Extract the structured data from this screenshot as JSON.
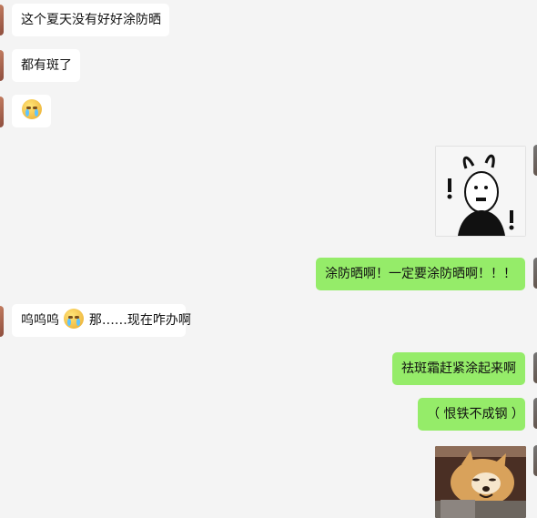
{
  "messages": [
    {
      "side": "left",
      "text": "这个夏天没有好好涂防晒"
    },
    {
      "side": "left",
      "text": "都有斑了"
    },
    {
      "side": "left",
      "emoji": "crying-emoji"
    },
    {
      "side": "right",
      "sticker": "black-figure-sticker"
    },
    {
      "side": "right",
      "text": "涂防晒啊！一定要涂防晒啊！！！"
    },
    {
      "side": "left",
      "text_before": "呜呜呜",
      "emoji": "crying-emoji",
      "text_after": "那……现在咋办啊"
    },
    {
      "side": "right",
      "text": "祛斑霜赶紧涂起来啊"
    },
    {
      "side": "right",
      "text": "（ 恨铁不成钢 ）"
    },
    {
      "side": "right",
      "photo": "dog-photo"
    }
  ],
  "colors": {
    "chat_bg": "#f4f4f4",
    "left_bubble": "#ffffff",
    "right_bubble": "#95ec69"
  }
}
